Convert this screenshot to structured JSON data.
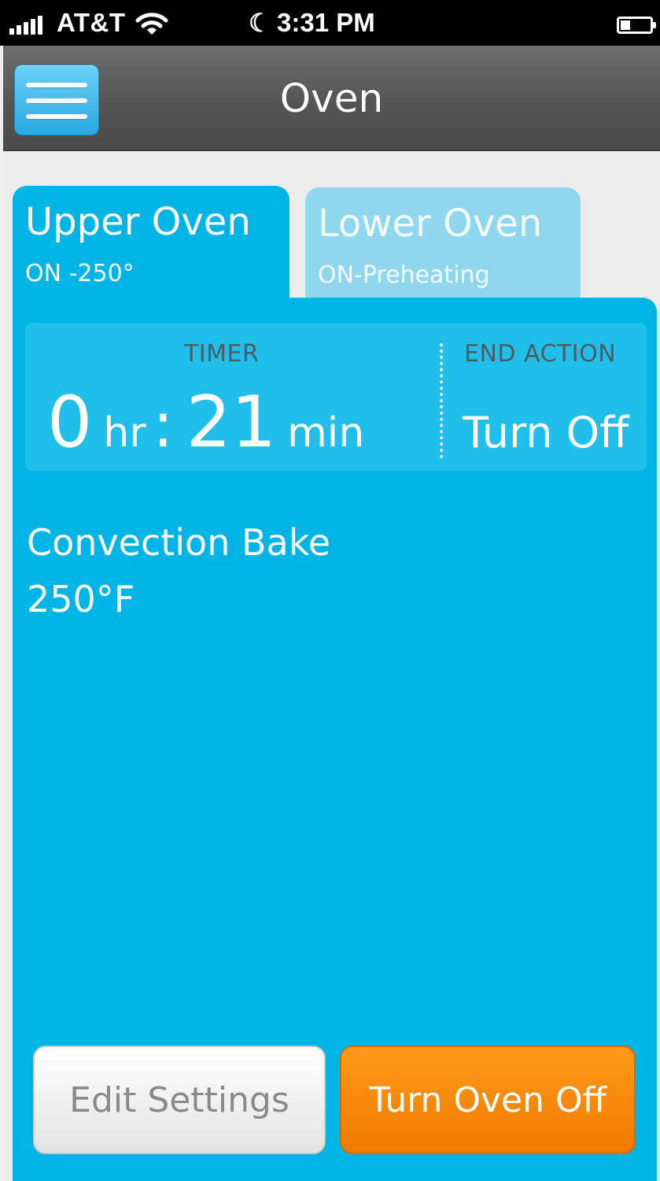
{
  "status_bar": {
    "carrier": "AT&T",
    "time": "3:31 PM",
    "icons": [
      "signal-bars-icon",
      "wifi-icon",
      "moon-icon",
      "battery-icon"
    ]
  },
  "nav": {
    "title": "Oven",
    "menu_icon": "hamburger-menu-icon"
  },
  "tabs": [
    {
      "name": "Upper Oven",
      "status": "ON -250°",
      "active": true
    },
    {
      "name": "Lower Oven",
      "status": "ON-Preheating",
      "active": false
    }
  ],
  "timer": {
    "label": "TIMER",
    "hours": "0",
    "hours_unit": "hr",
    "separator": ":",
    "minutes": "21",
    "minutes_unit": "min"
  },
  "end_action": {
    "label": "END ACTION",
    "value": "Turn Off"
  },
  "mode": {
    "name": "Convection Bake",
    "temperature": "250°F"
  },
  "buttons": {
    "edit_settings": "Edit Settings",
    "turn_oven_off": "Turn Oven Off"
  },
  "colors": {
    "accent_blue": "#00b5e6",
    "inactive_tab": "#8fd7ee",
    "orange_button": "#f07a00"
  }
}
